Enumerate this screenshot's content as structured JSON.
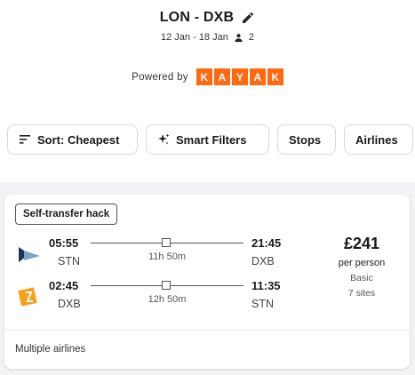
{
  "header": {
    "route": "LON - DXB",
    "dates": "12 Jan - 18 Jan",
    "travellers": "2",
    "powered_by": "Powered by",
    "brand_letters": [
      "K",
      "A",
      "Y",
      "A",
      "K"
    ]
  },
  "filters": {
    "sort": "Sort: Cheapest",
    "smart": "Smart Filters",
    "stops": "Stops",
    "airlines": "Airlines"
  },
  "result": {
    "badge": "Self-transfer hack",
    "outbound": {
      "depart_time": "05:55",
      "depart_airport": "STN",
      "duration": "11h 50m",
      "arrive_time": "21:45",
      "arrive_airport": "DXB"
    },
    "inbound": {
      "depart_time": "02:45",
      "depart_airport": "DXB",
      "duration": "12h 50m",
      "arrive_time": "11:35",
      "arrive_airport": "STN"
    },
    "price": "£241",
    "price_unit": "per person",
    "fare_type": "Basic",
    "sites": "7 sites",
    "airlines_note": "Multiple airlines"
  },
  "colors": {
    "brand": "#ff690f",
    "background": "#f3f3f5"
  }
}
